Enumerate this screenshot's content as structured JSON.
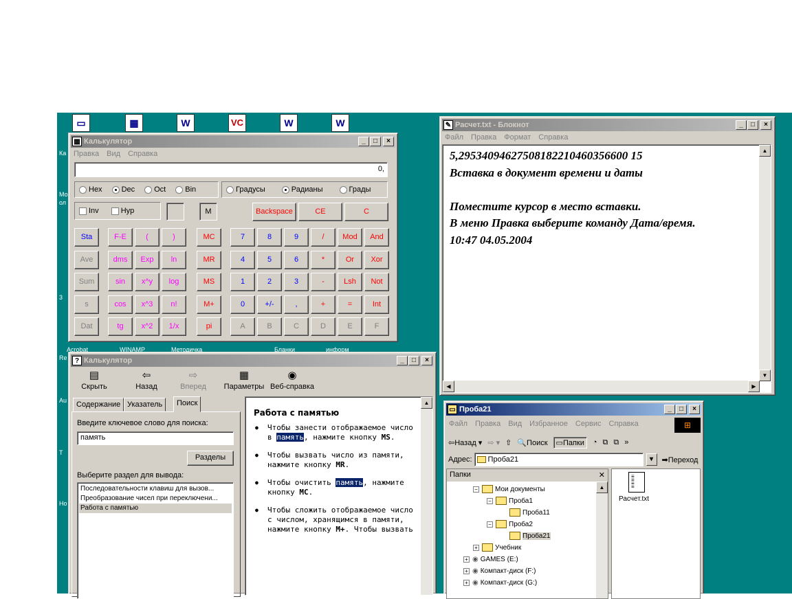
{
  "desktop": {
    "icons": [
      {
        "label": "Acrobat",
        "icon": "monitor-icon",
        "glyph": "▭"
      },
      {
        "label": "WINAMP",
        "icon": "calc-app-icon",
        "glyph": "▦"
      },
      {
        "label": "Методичка",
        "icon": "word-doc-icon",
        "glyph": "W"
      },
      {
        "label": "",
        "icon": "visual-c-icon",
        "glyph": "VC"
      },
      {
        "label": "Бланки",
        "icon": "word-doc-icon",
        "glyph": "W"
      },
      {
        "label": "информ",
        "icon": "word-doc-icon",
        "glyph": "W"
      }
    ],
    "left_fragments": [
      "Ка",
      "Мо",
      "ол",
      "3",
      "Re",
      "Au",
      "Т",
      "Но"
    ]
  },
  "calculator": {
    "title": "Калькулятор",
    "menu": [
      "Правка",
      "Вид",
      "Справка"
    ],
    "display": "0,",
    "radix": [
      {
        "label": "Hex",
        "on": false
      },
      {
        "label": "Dec",
        "on": true
      },
      {
        "label": "Oct",
        "on": false
      },
      {
        "label": "Bin",
        "on": false
      }
    ],
    "angle": [
      {
        "label": "Градусы",
        "on": false
      },
      {
        "label": "Радианы",
        "on": true
      },
      {
        "label": "Грады",
        "on": false
      }
    ],
    "inv": "Inv",
    "hyp": "Hyp",
    "mem_indicator": "M",
    "backspace": "Backspace",
    "ce": "CE",
    "c": "C",
    "rows": [
      [
        "Sta",
        "F-E",
        "(",
        ")",
        "MC",
        "7",
        "8",
        "9",
        "/",
        "Mod",
        "And"
      ],
      [
        "Ave",
        "dms",
        "Exp",
        "ln",
        "MR",
        "4",
        "5",
        "6",
        "*",
        "Or",
        "Xor"
      ],
      [
        "Sum",
        "sin",
        "x^y",
        "log",
        "MS",
        "1",
        "2",
        "3",
        "-",
        "Lsh",
        "Not"
      ],
      [
        "s",
        "cos",
        "x^3",
        "n!",
        "M+",
        "0",
        "+/-",
        ",",
        "+",
        "=",
        "Int"
      ],
      [
        "Dat",
        "tg",
        "x^2",
        "1/x",
        "pi",
        "A",
        "B",
        "C",
        "D",
        "E",
        "F"
      ]
    ],
    "colors": [
      "blue",
      "mag",
      "mag",
      "mag",
      "red",
      "blue",
      "blue",
      "blue",
      "red",
      "red",
      "red"
    ],
    "gray_cells": [
      [
        1,
        0
      ],
      [
        2,
        0
      ],
      [
        3,
        0
      ],
      [
        4,
        0
      ],
      [
        4,
        5
      ],
      [
        4,
        6
      ],
      [
        4,
        7
      ],
      [
        4,
        8
      ],
      [
        4,
        9
      ],
      [
        4,
        10
      ]
    ]
  },
  "help": {
    "title": "Калькулятор",
    "toolbar": [
      "Скрыть",
      "Назад",
      "Вперед",
      "Параметры",
      "Веб-справка"
    ],
    "tabs": [
      "Содержание",
      "Указатель",
      "Поиск"
    ],
    "keyword_label": "Введите ключевое слово для поиска:",
    "keyword_value": "память",
    "sections_button": "Разделы",
    "choose_label": "Выберите раздел для вывода:",
    "topics": [
      "Последовательности клавиш для вызов...",
      "Преобразование чисел при переключени...",
      "Работа с памятью"
    ],
    "article_title": "Работа с памятью",
    "bullets": [
      {
        "a": "Чтобы занести отображаемое число в ",
        "hl": "память",
        "b": ", нажмите кнопку ",
        "key": "MS",
        "c": "."
      },
      {
        "a": "Чтобы вызвать число из памяти, нажмите кнопку ",
        "hl": "",
        "b": "",
        "key": "MR",
        "c": "."
      },
      {
        "a": "Чтобы очистить ",
        "hl": "память",
        "b": ", нажмите кнопку ",
        "key": "MC",
        "c": "."
      },
      {
        "a": "Чтобы сложить отображаемое число с числом, хранящимся в памяти, нажмите кнопку ",
        "hl": "",
        "b": "",
        "key": "M+",
        "c": ". Чтобы вызвать"
      }
    ]
  },
  "notepad": {
    "title": "Расчет.txt - Блокнот",
    "menu": [
      "Файл",
      "Правка",
      "Формат",
      "Справка"
    ],
    "lines": [
      "5,29534094627508182210460356600 15",
      "Вставка в документ времени и даты",
      "",
      "Поместите курсор в место вставки.",
      "В меню Правка выберите команду Дата/время.",
      "10:47 04.05.2004"
    ]
  },
  "explorer": {
    "title": "Проба21",
    "menu": [
      "Файл",
      "Правка",
      "Вид",
      "Избранное",
      "Сервис",
      "Справка"
    ],
    "toolbar": {
      "back": "Назад",
      "search": "Поиск",
      "folders": "Папки"
    },
    "address_label": "Адрес:",
    "address_value": "Проба21",
    "go": "Переход",
    "folders_header": "Папки",
    "tree": [
      {
        "label": "Мои документы",
        "level": 0,
        "pm": "−"
      },
      {
        "label": "Проба1",
        "level": 1,
        "pm": "−"
      },
      {
        "label": "Проба11",
        "level": 2,
        "pm": ""
      },
      {
        "label": "Проба2",
        "level": 1,
        "pm": "−"
      },
      {
        "label": "Проба21",
        "level": 2,
        "pm": ""
      },
      {
        "label": "Учебник",
        "level": 0,
        "pm": "+"
      },
      {
        "label": "GAMES (E:)",
        "level": -1,
        "pm": "+"
      },
      {
        "label": "Компакт-диск (F:)",
        "level": -1,
        "pm": "+"
      },
      {
        "label": "Компакт-диск (G:)",
        "level": -1,
        "pm": "+"
      }
    ],
    "file": "Расчет.txt"
  }
}
